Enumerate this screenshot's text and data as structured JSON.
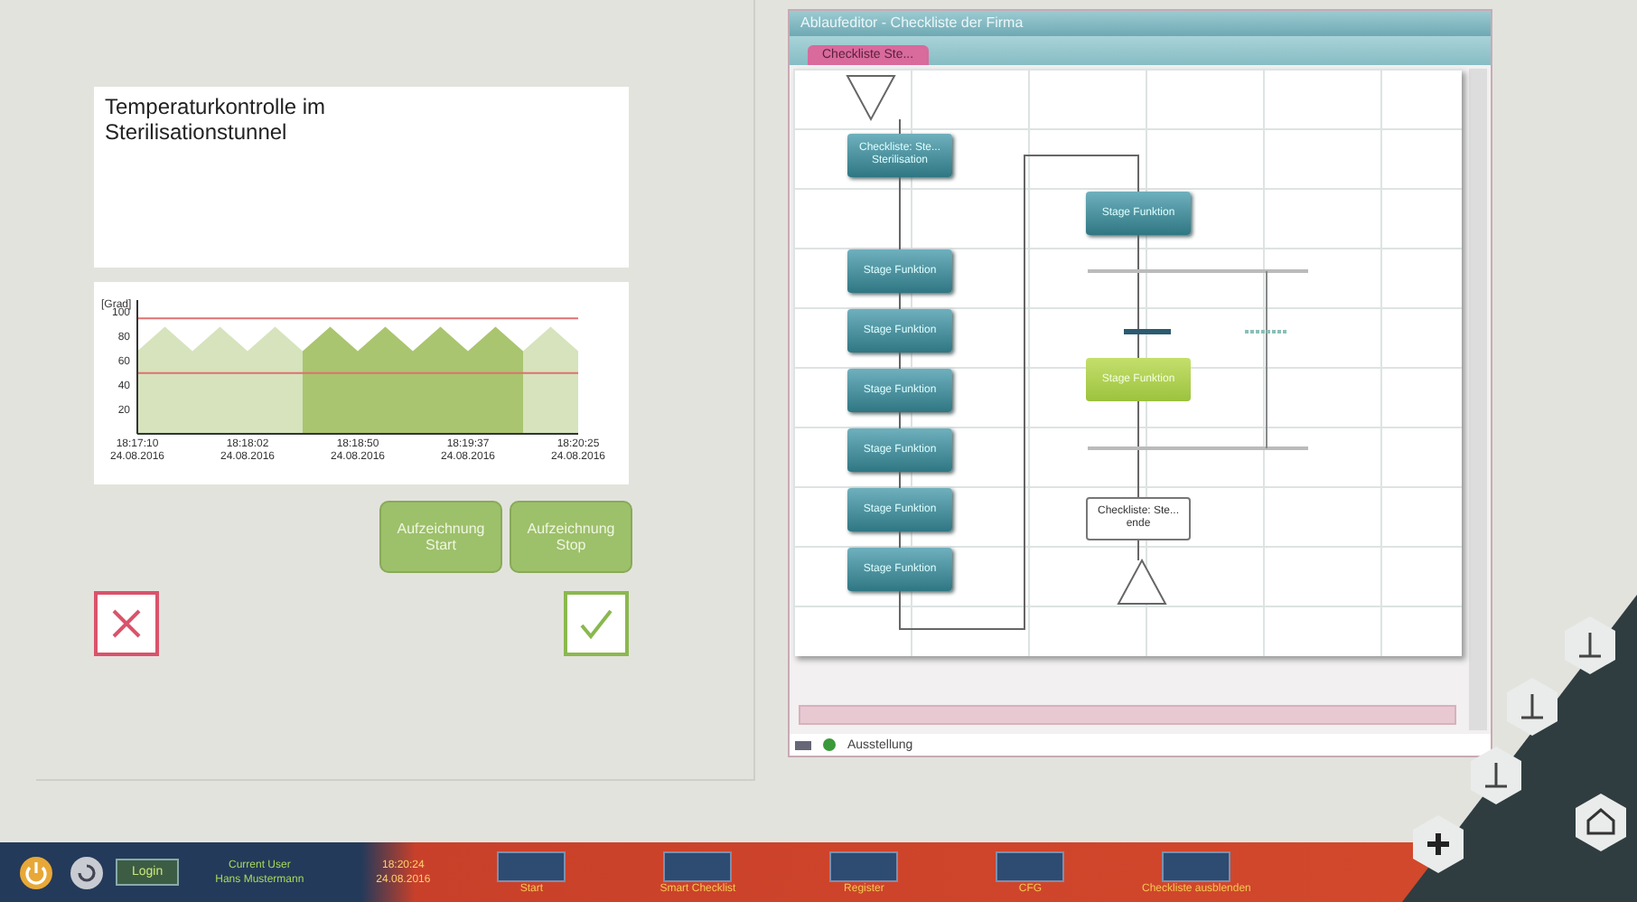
{
  "task": {
    "title": "Temperaturkontrolle im Sterilisationstunnel"
  },
  "chart_data": {
    "type": "area",
    "ylabel": "[Grad]",
    "categories": [
      "18:17:10\n24.08.2016",
      null,
      null,
      null,
      "18:18:02\n24.08.2016",
      null,
      null,
      null,
      "18:18:50\n24.08.2016",
      null,
      null,
      null,
      "18:19:37\n24.08.2016",
      null,
      null,
      null,
      "18:20:25\n24.08.2016"
    ],
    "series": [
      {
        "color": "#d6e3bd",
        "values": [
          68,
          88,
          68,
          88,
          68,
          88,
          68,
          null,
          null,
          null,
          null,
          null,
          null,
          null,
          68,
          88,
          68
        ]
      },
      {
        "color": "#a9c56f",
        "values": [
          null,
          null,
          null,
          null,
          null,
          null,
          68,
          88,
          68,
          88,
          68,
          88,
          68,
          88,
          68,
          null,
          null
        ]
      }
    ],
    "ref_lines": [
      {
        "axis": "y",
        "value": 95,
        "color": "#e07070"
      },
      {
        "axis": "y",
        "value": 50,
        "color": "#e07070"
      }
    ],
    "ylim": [
      0,
      110
    ],
    "yticks": [
      20,
      40,
      60,
      80,
      100
    ]
  },
  "record_buttons": [
    "Aufzeichnung Start",
    "Aufzeichnung Stop"
  ],
  "editor": {
    "title": "Ablaufeditor - Checkliste der Firma",
    "tab": "Checkliste Ste...",
    "nodes": [
      {
        "kind": "start"
      },
      {
        "kind": "stage",
        "text": "Checkliste: Ste... Sterilisation"
      },
      {
        "kind": "stage",
        "text": "Stage Funktion"
      },
      {
        "kind": "stage",
        "text": "Stage Funktion"
      },
      {
        "kind": "stage",
        "text": "Stage Funktion"
      },
      {
        "kind": "stage",
        "text": "Stage Funktion"
      },
      {
        "kind": "stage",
        "text": "Stage Funktion"
      },
      {
        "kind": "stage",
        "text": "Stage Funktion"
      },
      {
        "kind": "stage",
        "text": "Stage Funktion"
      },
      {
        "kind": "active",
        "text": "Stage Funktion"
      },
      {
        "kind": "plain",
        "text": "Checkliste: Ste... ende"
      },
      {
        "kind": "end"
      }
    ],
    "status": "Ausstellung"
  },
  "taskbar": {
    "login": "Login",
    "user": [
      "Current User",
      "Hans Mustermann"
    ],
    "time": [
      "18:20:24",
      "24.08.2016"
    ],
    "buttons": [
      "Start",
      "Smart Checklist",
      "Register",
      "CFG",
      "Checkliste ausblenden"
    ]
  }
}
